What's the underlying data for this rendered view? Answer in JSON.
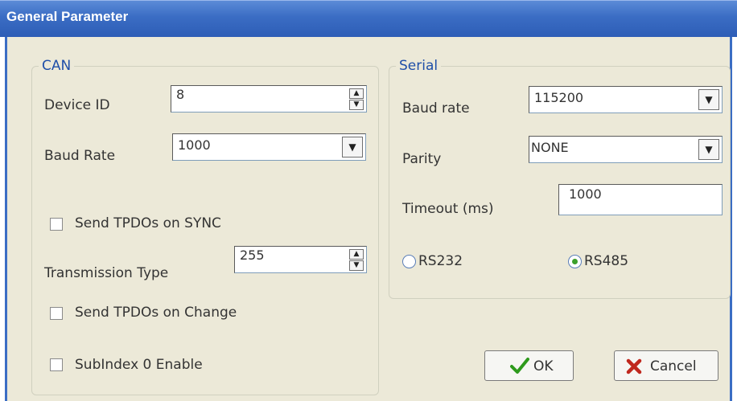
{
  "window": {
    "title": "General Parameter"
  },
  "can": {
    "legend": "CAN",
    "device_id": {
      "label": "Device ID",
      "value": "8"
    },
    "baud_rate": {
      "label": "Baud Rate",
      "value": "1000"
    },
    "send_tpdos_on_sync": {
      "label": "Send TPDOs on SYNC",
      "checked": false
    },
    "transmission_type": {
      "label": "Transmission Type",
      "value": "255"
    },
    "send_tpdos_on_change": {
      "label": "Send TPDOs on Change",
      "checked": false
    },
    "subindex0_enable": {
      "label": "SubIndex 0 Enable",
      "checked": false
    }
  },
  "serial": {
    "legend": "Serial",
    "baud_rate": {
      "label": "Baud rate",
      "value": "115200"
    },
    "parity": {
      "label": "Parity",
      "value": "NONE"
    },
    "timeout": {
      "label": "Timeout (ms)",
      "value": "1000"
    },
    "interface": {
      "options": [
        "RS232",
        "RS485"
      ],
      "selected": "RS485"
    }
  },
  "buttons": {
    "ok": "OK",
    "cancel": "Cancel"
  },
  "colors": {
    "title_bar": "#3b6dc4",
    "legend_text": "#1f4fa8",
    "ok_check": "#2e9a1c",
    "cancel_x": "#c0281e",
    "radio_dot": "#3da02a"
  }
}
